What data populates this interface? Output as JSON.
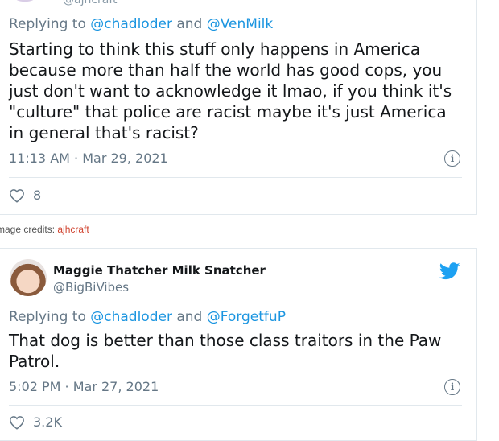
{
  "tweet1": {
    "prev_handle": "@ajhcraft",
    "replying_prefix": "Replying to",
    "mention1": "@chadloder",
    "and": "and",
    "mention2": "@VenMilk",
    "text": "Starting to think this stuff only happens in America because more than half the world has good cops, you just don't want to acknowledge it lmao, if you think it's \"culture\" that police are racist maybe it's just America in general that's racist?",
    "timestamp": "11:13 AM · Mar 29, 2021",
    "likes": "8"
  },
  "credits": {
    "label": "mage credits:",
    "author": "ajhcraft"
  },
  "tweet2": {
    "display_name": "Maggie Thatcher Milk Snatcher",
    "handle": "@BigBiVibes",
    "replying_prefix": "Replying to",
    "mention1": "@chadloder",
    "and": "and",
    "mention2": "@ForgetfuP",
    "text": "That dog is better than those class traitors in the Paw Patrol.",
    "timestamp": "5:02 PM · Mar 27, 2021",
    "likes": "3.2K"
  },
  "colors": {
    "accent": "#1b95e0",
    "muted": "#657786",
    "credit_link": "#d0432f"
  }
}
